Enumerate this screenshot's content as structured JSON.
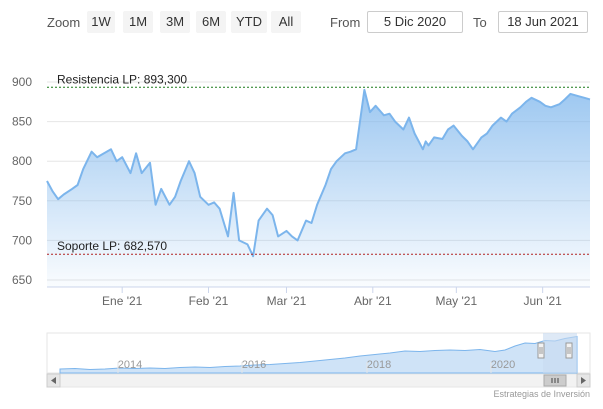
{
  "toolbar": {
    "zoom_label": "Zoom",
    "buttons": [
      "1W",
      "1M",
      "3M",
      "6M",
      "YTD",
      "All"
    ],
    "from_label": "From",
    "from_value": "5 Dic 2020",
    "to_label": "To",
    "to_value": "18 Jun 2021"
  },
  "credit": "Estrategias de Inversión",
  "chart_data": {
    "type": "area",
    "title": "",
    "ylim": [
      650,
      900
    ],
    "yticks": [
      650,
      700,
      750,
      800,
      850,
      900
    ],
    "xlim": [
      "2020-12-05",
      "2021-06-18"
    ],
    "xticks": [
      {
        "date": "2021-01-01",
        "label": "Ene '21"
      },
      {
        "date": "2021-02-01",
        "label": "Feb '21"
      },
      {
        "date": "2021-03-01",
        "label": "Mar '21"
      },
      {
        "date": "2021-04-01",
        "label": "Abr '21"
      },
      {
        "date": "2021-05-01",
        "label": "May '21"
      },
      {
        "date": "2021-06-01",
        "label": "Jun '21"
      }
    ],
    "grid": true,
    "colors": {
      "line": "#7cb5ec",
      "resistance": "#1a7a1a",
      "support": "#b22222"
    },
    "series": [
      {
        "x": [
          "2020-12-05",
          "2020-12-07",
          "2020-12-09",
          "2020-12-11",
          "2020-12-14",
          "2020-12-16",
          "2020-12-18",
          "2020-12-21",
          "2020-12-23",
          "2020-12-28",
          "2020-12-30",
          "2021-01-01",
          "2021-01-04",
          "2021-01-06",
          "2021-01-08",
          "2021-01-11",
          "2021-01-13",
          "2021-01-15",
          "2021-01-18",
          "2021-01-20",
          "2021-01-22",
          "2021-01-25",
          "2021-01-27",
          "2021-01-29",
          "2021-02-01",
          "2021-02-03",
          "2021-02-05",
          "2021-02-08",
          "2021-02-10",
          "2021-02-12",
          "2021-02-15",
          "2021-02-17",
          "2021-02-19",
          "2021-02-22",
          "2021-02-24",
          "2021-02-26",
          "2021-03-01",
          "2021-03-03",
          "2021-03-05",
          "2021-03-08",
          "2021-03-10",
          "2021-03-12",
          "2021-03-15",
          "2021-03-17",
          "2021-03-19",
          "2021-03-22",
          "2021-03-24",
          "2021-03-26",
          "2021-03-29",
          "2021-03-31",
          "2021-04-02",
          "2021-04-05",
          "2021-04-07",
          "2021-04-09",
          "2021-04-12",
          "2021-04-14",
          "2021-04-16",
          "2021-04-19",
          "2021-04-20",
          "2021-04-21",
          "2021-04-23",
          "2021-04-26",
          "2021-04-28",
          "2021-04-30",
          "2021-05-03",
          "2021-05-05",
          "2021-05-07",
          "2021-05-10",
          "2021-05-12",
          "2021-05-14",
          "2021-05-17",
          "2021-05-19",
          "2021-05-21",
          "2021-05-24",
          "2021-05-26",
          "2021-05-28",
          "2021-05-31",
          "2021-06-02",
          "2021-06-04",
          "2021-06-07",
          "2021-06-09",
          "2021-06-11",
          "2021-06-14",
          "2021-06-16",
          "2021-06-18"
        ],
        "y": [
          775,
          762,
          752,
          758,
          765,
          770,
          790,
          812,
          805,
          815,
          800,
          805,
          785,
          810,
          785,
          798,
          745,
          765,
          745,
          755,
          775,
          800,
          785,
          755,
          745,
          748,
          740,
          705,
          760,
          700,
          695,
          680,
          725,
          740,
          732,
          705,
          712,
          705,
          700,
          725,
          722,
          745,
          770,
          790,
          800,
          810,
          812,
          815,
          890,
          862,
          870,
          858,
          860,
          850,
          840,
          855,
          835,
          815,
          825,
          820,
          830,
          828,
          840,
          845,
          832,
          825,
          815,
          830,
          835,
          845,
          855,
          850,
          860,
          868,
          875,
          880,
          875,
          870,
          868,
          872,
          878,
          885,
          882,
          880,
          878
        ]
      }
    ],
    "annotations": [
      {
        "label": "Resistencia LP: 893,300",
        "value": 893.3
      },
      {
        "label": "Soporte LP: 682,570",
        "value": 682.57
      }
    ],
    "navigator": {
      "year_labels": [
        "2014",
        "2016",
        "2018",
        "2020"
      ]
    }
  }
}
